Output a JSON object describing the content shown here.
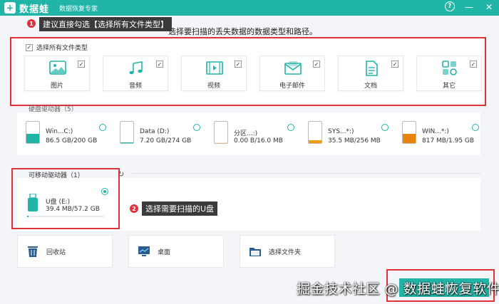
{
  "app": {
    "logo_glyph": "+",
    "brand": "数据蛙",
    "subtitle": "数据恢复专家",
    "help_glyph": "?",
    "minimize_glyph": "—",
    "close_glyph": "✕",
    "accent_color": "#21b5a8",
    "annotation_color": "#e0323b"
  },
  "annotations": {
    "step1": {
      "number": "1",
      "text": "建议直接勾选【选择所有文件类型】"
    },
    "step2": {
      "number": "2",
      "text": "选择需要扫描的U盘"
    }
  },
  "instruction": "选择要扫描的丢失数据的数据类型和路径。",
  "file_types": {
    "select_all_label": "选择所有文件类型",
    "check_glyph": "✓",
    "items": [
      {
        "label": "图片",
        "icon": "image-icon",
        "checked": true
      },
      {
        "label": "音频",
        "icon": "music-icon",
        "checked": true
      },
      {
        "label": "视频",
        "icon": "video-icon",
        "checked": true
      },
      {
        "label": "电子邮件",
        "icon": "email-icon",
        "checked": true
      },
      {
        "label": "文档",
        "icon": "document-icon",
        "checked": true
      },
      {
        "label": "其它",
        "icon": "other-icon",
        "checked": true
      }
    ]
  },
  "hard_drives": {
    "title": "硬盘驱动器（5）",
    "items": [
      {
        "name": "Win...C:)",
        "size": "86.5 GB/200 GB",
        "usage": 0.43,
        "color": "#21b5a8"
      },
      {
        "name": "Data (D:)",
        "size": "7.20 GB/274 GB",
        "usage": 0.03,
        "color": "#21b5a8"
      },
      {
        "name": "分区...:)",
        "size": "0.00  B/16.0 MB",
        "usage": 0.0,
        "color": "#f39c12"
      },
      {
        "name": "SYS...*:)",
        "size": "35.5 MB/256 MB",
        "usage": 0.14,
        "color": "#f39c12"
      },
      {
        "name": "WIN...*:)",
        "size": "817 MB/1.95 GB",
        "usage": 0.42,
        "color": "#e8830c"
      }
    ]
  },
  "removable": {
    "title": "可移动驱动器（1）",
    "refresh_glyph": "↻",
    "usb": {
      "name": "U盘 (E:)",
      "size": "39.4 MB/57.2 GB",
      "selected": true
    }
  },
  "locations": [
    {
      "label": "回收站",
      "icon": "recycle-bin-icon"
    },
    {
      "label": "桌面",
      "icon": "desktop-icon"
    },
    {
      "label": "选择文件夹",
      "icon": "folder-icon"
    }
  ],
  "scan_button": "扫描",
  "watermark": "掘金技术社区 @ 数据蛙恢复软件"
}
